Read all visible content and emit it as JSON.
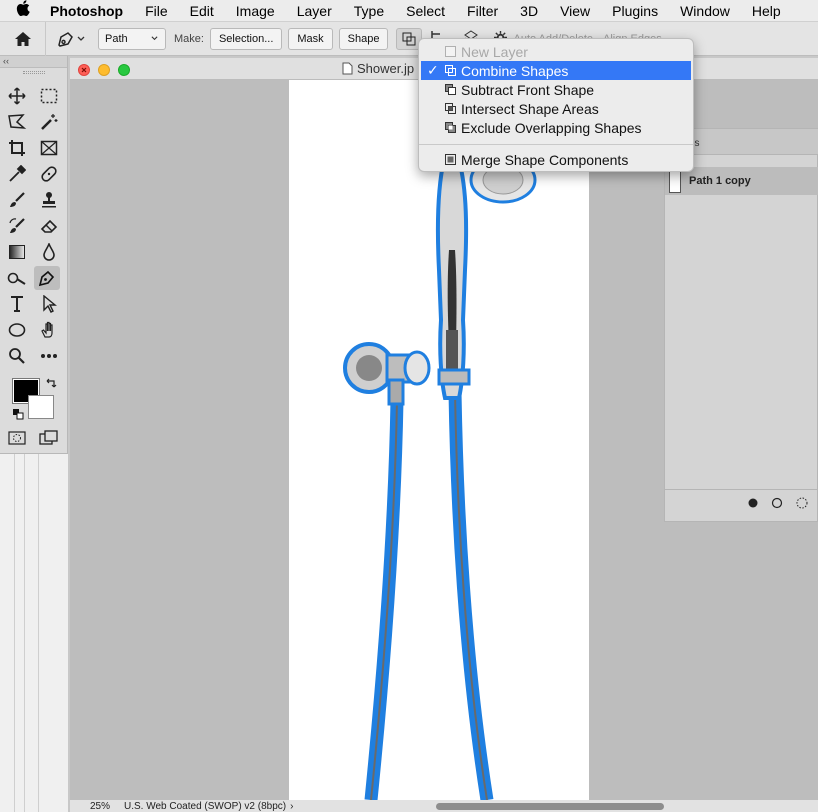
{
  "menubar": {
    "app_name": "Photoshop",
    "items": [
      "File",
      "Edit",
      "Image",
      "Layer",
      "Type",
      "Select",
      "Filter",
      "3D",
      "View",
      "Plugins",
      "Window",
      "Help"
    ]
  },
  "options_bar": {
    "path_mode": "Path",
    "make_label": "Make:",
    "selection_button": "Selection...",
    "mask_button": "Mask",
    "shape_button": "Shape",
    "auto_add_delete": "Auto Add/Delete",
    "align_edges": "Align Edges"
  },
  "toolbar": {
    "collapse_glyph": "‹‹"
  },
  "document": {
    "title": "Shower.jp",
    "zoom": "25%",
    "color_profile": "U.S. Web Coated (SWOP) v2 (8bpc)",
    "status_arrow": "›"
  },
  "path_ops_menu": {
    "items": [
      {
        "label": "New Layer",
        "icon": "new-layer-icon",
        "disabled": true,
        "checked": false
      },
      {
        "label": "Combine Shapes",
        "icon": "combine-shapes-icon",
        "disabled": false,
        "checked": true
      },
      {
        "label": "Subtract Front Shape",
        "icon": "subtract-front-shape-icon",
        "disabled": false,
        "checked": false
      },
      {
        "label": "Intersect Shape Areas",
        "icon": "intersect-shape-areas-icon",
        "disabled": false,
        "checked": false
      },
      {
        "label": "Exclude Overlapping Shapes",
        "icon": "exclude-overlapping-shapes-icon",
        "disabled": false,
        "checked": false
      }
    ],
    "merge_label": "Merge Shape Components",
    "check_glyph": "✓"
  },
  "paths_panel": {
    "tab_label": "hs",
    "path_name": "Path 1 copy"
  },
  "colors": {
    "accent": "#3478f6",
    "path_blue": "#1f7fe0",
    "foreground": "#000000",
    "background": "#ffffff"
  }
}
